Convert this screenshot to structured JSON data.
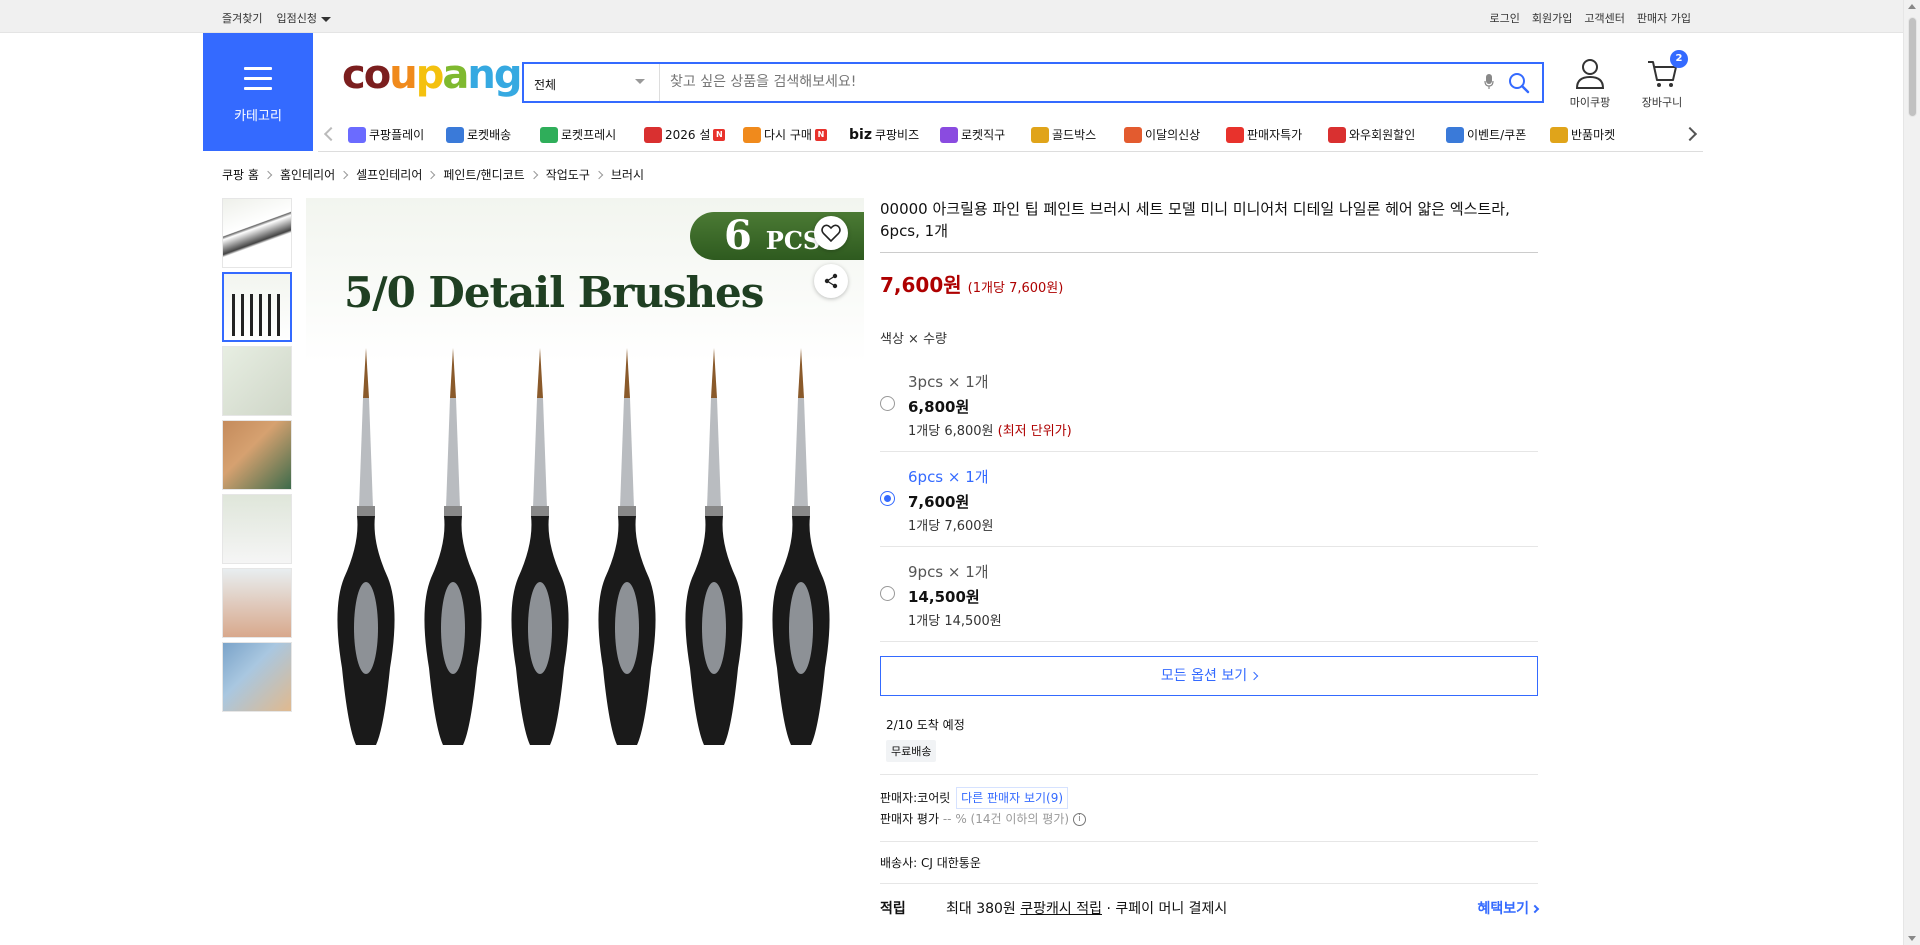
{
  "topbar": {
    "left": [
      "즐겨찾기",
      "입점신청"
    ],
    "right": [
      "로그인",
      "회원가입",
      "고객센터",
      "판매자 가입"
    ]
  },
  "header": {
    "category_label": "카테고리",
    "logo": [
      "c",
      "o",
      "u",
      "p",
      "a",
      "n",
      "g"
    ],
    "logo_colors": [
      "#7b1e1e",
      "#7b1e1e",
      "#f08a1c",
      "#f4c10f",
      "#7fb92f",
      "#36a9e1",
      "#36a9e1"
    ],
    "search": {
      "category": "전체",
      "placeholder": "찾고 싶은 상품을 검색해보세요!"
    },
    "mypage": "마이쿠팡",
    "cart": "장바구니",
    "cart_count": "2",
    "accent": "#346aff"
  },
  "quicknav": [
    {
      "label": "쿠팡플레이",
      "icon": "play-icon",
      "color": "#6b6bff"
    },
    {
      "label": "로켓배송",
      "icon": "rocket-icon",
      "color": "#3a7ad9"
    },
    {
      "label": "로켓프레시",
      "icon": "rocket-fresh-icon",
      "color": "#2fae5a"
    },
    {
      "label": "2026 설",
      "icon": "gift-icon",
      "color": "#d93030",
      "new": true
    },
    {
      "label": "다시 구매",
      "icon": "home-icon",
      "color": "#f08a1c",
      "new": true
    },
    {
      "label": "쿠팡비즈",
      "prefix": "biz",
      "icon": "biz-icon",
      "color": "#111111"
    },
    {
      "label": "로켓직구",
      "icon": "global-icon",
      "color": "#8a4be0"
    },
    {
      "label": "골드박스",
      "icon": "goldbox-icon",
      "color": "#e0a41a"
    },
    {
      "label": "이달의신상",
      "icon": "new-bag-icon",
      "color": "#e35b2f"
    },
    {
      "label": "판매자특가",
      "icon": "percent-icon",
      "color": "#e8322c"
    },
    {
      "label": "와우회원할인",
      "icon": "wow-icon",
      "color": "#d93030"
    },
    {
      "label": "이벤트/쿠폰",
      "icon": "coupon-icon",
      "color": "#3a7ad9"
    },
    {
      "label": "반품마켓",
      "icon": "market-icon",
      "color": "#e0a41a"
    }
  ],
  "breadcrumb": [
    "쿠팡 홈",
    "홈인테리어",
    "셀프인테리어",
    "페인트/핸디코트",
    "작업도구",
    "브러시"
  ],
  "gallery": {
    "heading": "5/0 Detail Brushes",
    "badge_num": "6",
    "badge_unit": "PCS",
    "brush_count": 6
  },
  "product": {
    "title": "00000 아크릴용 파인 팁 페인트 브러시 세트 모델 미니 미니어처 디테일 나일론 헤어 얇은 엑스트라, 6pcs, 1개",
    "price": "7,600원",
    "unit_price": "(1개당 7,600원)",
    "option_label": "색상 × 수량",
    "options": [
      {
        "name": "3pcs × 1개",
        "price": "6,800원",
        "unit": "1개당 6,800원",
        "badge": "(최저 단위가)",
        "selected": false
      },
      {
        "name": "6pcs × 1개",
        "price": "7,600원",
        "unit": "1개당 7,600원",
        "badge": "",
        "selected": true
      },
      {
        "name": "9pcs × 1개",
        "price": "14,500원",
        "unit": "1개당 14,500원",
        "badge": "",
        "selected": false
      }
    ],
    "all_options": "모든 옵션 보기",
    "arrival": "2/10 도착 예정",
    "free_shipping": "무료배송",
    "seller_label": "판매자:",
    "seller_name": "코어릿",
    "other_sellers": "다른 판매자 보기(9)",
    "seller_rating_label": "판매자 평가",
    "seller_rating": "-- % (14건 이하의 평가)",
    "shipper": "배송사:  CJ 대한통운",
    "reward_label": "적립",
    "reward_text_a": "최대 380원 ",
    "reward_text_b": "쿠팡캐시 적립",
    "reward_text_c": " · 쿠페이 머니 결제시",
    "reward_more": "혜택보기"
  }
}
